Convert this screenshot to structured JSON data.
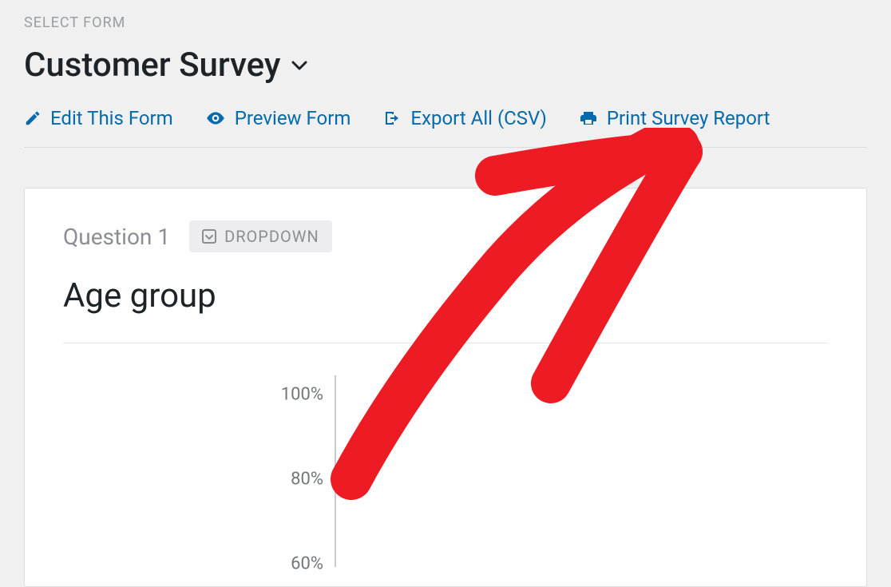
{
  "header": {
    "section_label": "SELECT FORM",
    "form_title": "Customer Survey"
  },
  "actions": {
    "edit": "Edit This Form",
    "preview": "Preview Form",
    "export": "Export All (CSV)",
    "print": "Print Survey Report"
  },
  "question": {
    "label": "Question 1",
    "type_badge": "DROPDOWN",
    "title": "Age group"
  },
  "chart_data": {
    "type": "bar",
    "title": "Age group",
    "ylabel": "",
    "xlabel": "",
    "ylim": [
      0,
      100
    ],
    "y_ticks": [
      "100%",
      "80%",
      "60%"
    ],
    "categories": [],
    "values": []
  }
}
